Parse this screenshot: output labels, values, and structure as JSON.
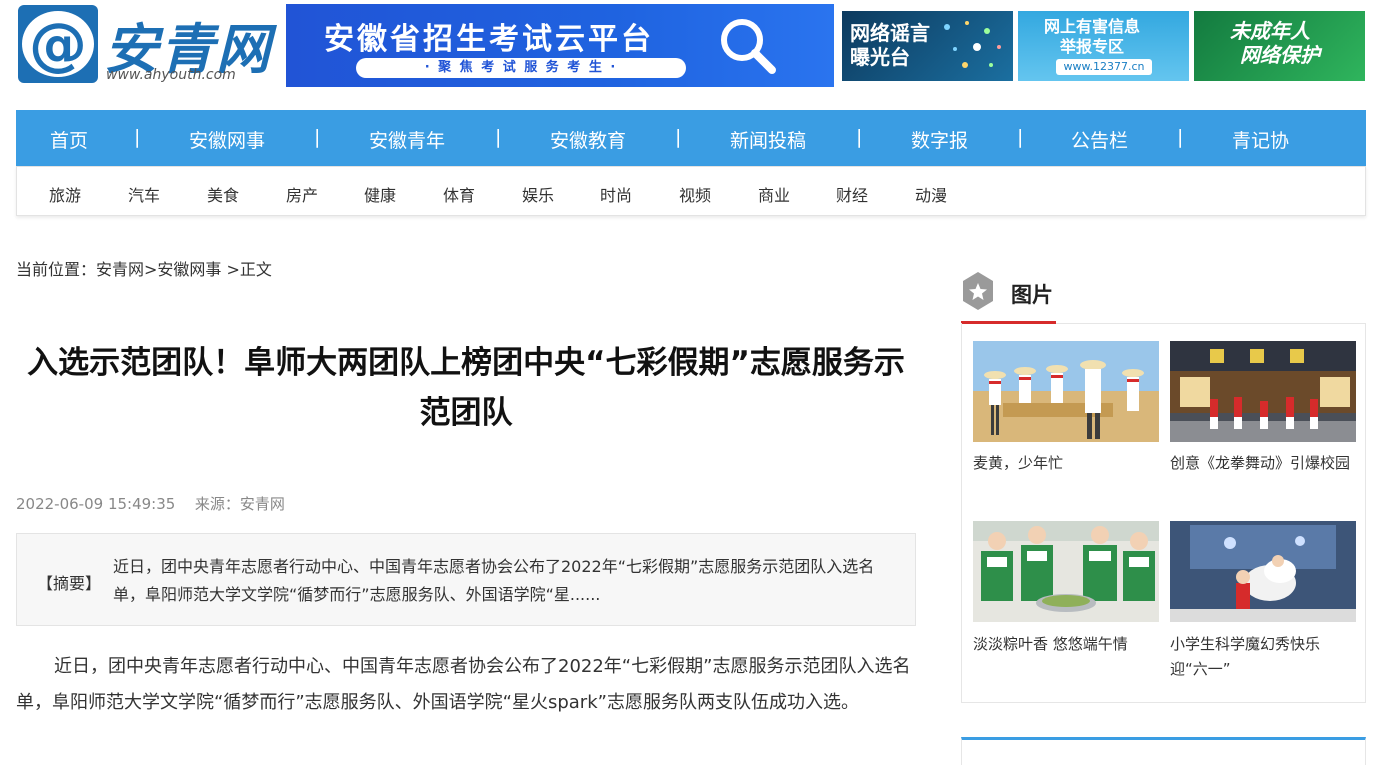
{
  "header": {
    "logo_name": "安青网",
    "logo_url": "www.ahyouth.com",
    "banner_main_title": "安徽省招生考试云平台",
    "banner_main_slogan": "· 聚 焦 考 试   服 务 考 生 ·",
    "banner_rumor": [
      "网络谣言",
      "曝光台"
    ],
    "banner_report": [
      "网上有害信息",
      "举报专区"
    ],
    "banner_report_url": "www.12377.cn",
    "banner_minor": [
      "未成年人",
      "网络保护"
    ]
  },
  "nav": {
    "main": [
      "首页",
      "安徽网事",
      "安徽青年",
      "安徽教育",
      "新闻投稿",
      "数字报",
      "公告栏",
      "青记协"
    ],
    "separator": "|",
    "sub": [
      "旅游",
      "汽车",
      "美食",
      "房产",
      "健康",
      "体育",
      "娱乐",
      "时尚",
      "视频",
      "商业",
      "财经",
      "动漫"
    ]
  },
  "breadcrumb": {
    "text": "当前位置：安青网>安徽网事 >正文"
  },
  "article": {
    "title": "入选示范团队！阜师大两团队上榜团中央“七彩假期”志愿服务示范团队",
    "datetime": "2022-06-09 15:49:35",
    "source": "来源：安青网",
    "summary_label": "【摘要】",
    "summary": "近日，团中央青年志愿者行动中心、中国青年志愿者协会公布了2022年“七彩假期”志愿服务示范团队入选名单，阜阳师范大学文学院“循梦而行”志愿服务队、外国语学院“星......",
    "body": "近日，团中央青年志愿者行动中心、中国青年志愿者协会公布了2022年“七彩假期”志愿服务示范团队入选名单，阜阳师范大学文学院“循梦而行”志愿服务队、外国语学院“星火spark”志愿服务队两支队伍成功入选。"
  },
  "sidebar": {
    "section_title": "图片",
    "photos": [
      {
        "caption": "麦黄，少年忙"
      },
      {
        "caption": "创意《龙拳舞动》引爆校园"
      },
      {
        "caption": "淡淡粽叶香 悠悠端午情"
      },
      {
        "caption": "小学生科学魔幻秀快乐迎“六一”"
      }
    ]
  },
  "colors": {
    "nav_blue": "#3a9de3",
    "logo_blue": "#1d6fb4",
    "accent_red": "#d62b2b"
  }
}
